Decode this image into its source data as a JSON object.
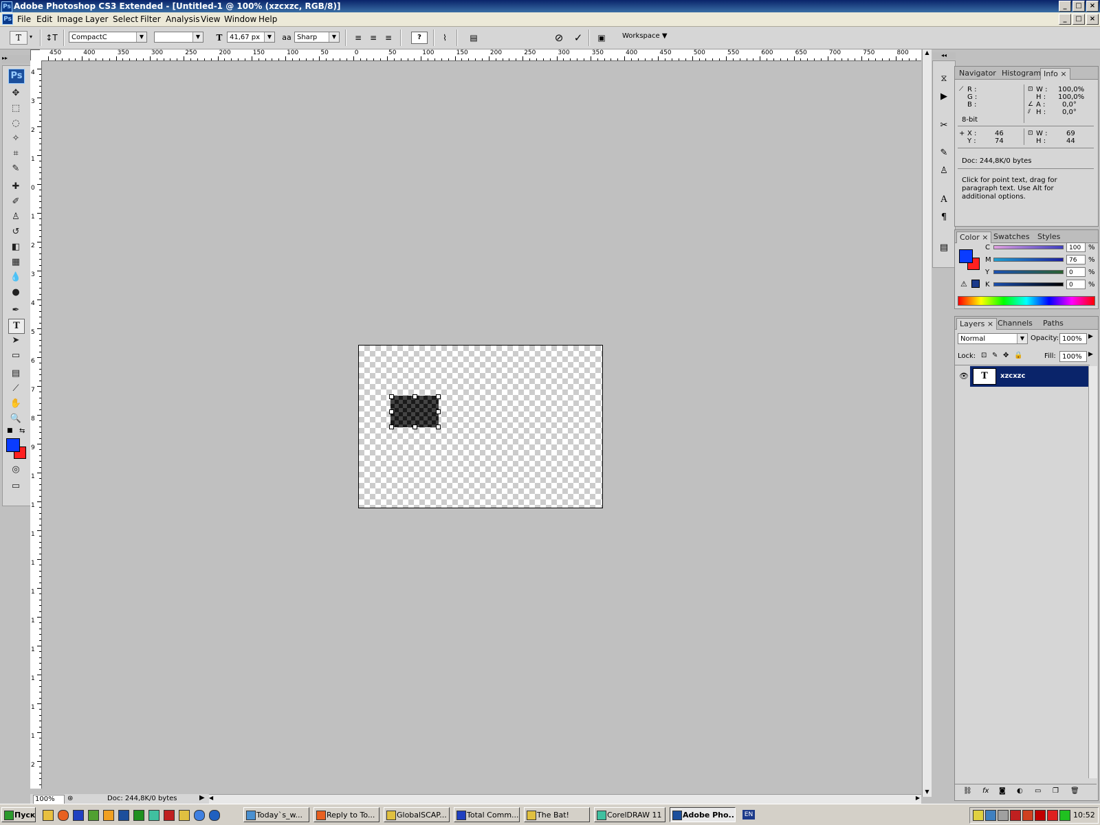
{
  "title": "Adobe Photoshop CS3 Extended - [Untitled-1 @ 100% (xzcxzc, RGB/8)]",
  "menu": [
    "File",
    "Edit",
    "Image",
    "Layer",
    "Select",
    "Filter",
    "Analysis",
    "View",
    "Window",
    "Help"
  ],
  "options": {
    "font_family": "CompactC",
    "font_style": "",
    "font_size": "41,67 px",
    "aa_label": "a",
    "antialias": "Sharp",
    "help_btn": "?",
    "workspace": "Workspace"
  },
  "ruler": {
    "h": [
      "450",
      "400",
      "350",
      "300",
      "250",
      "200",
      "150",
      "100",
      "50",
      "0",
      "50",
      "100",
      "150",
      "200",
      "250",
      "300",
      "350",
      "400",
      "450",
      "500",
      "550",
      "600",
      "650",
      "700",
      "750",
      "800"
    ],
    "v": [
      "4",
      "3",
      "2",
      "1",
      "0",
      "1",
      "2",
      "3",
      "4",
      "5",
      "6",
      "7",
      "8",
      "9",
      "1",
      "1",
      "1",
      "1",
      "1",
      "1",
      "1",
      "1",
      "1",
      "1",
      "2",
      "2"
    ]
  },
  "info_panel": {
    "tabs": [
      "Navigator",
      "Histogram",
      "Info"
    ],
    "r": "R :",
    "g": "G :",
    "b": "B :",
    "bit": "8-bit",
    "w_label": "W :",
    "w_val": "100,0%",
    "h_label": "H :",
    "h_val": "100,0%",
    "a_label": "A :",
    "a_val": "0,0°",
    "h2_label": "H :",
    "h2_val": "0,0°",
    "x_label": "X :",
    "x_val": "46",
    "y_label": "Y :",
    "y_val": "74",
    "sw_label": "W :",
    "sw_val": "69",
    "sh_label": "H :",
    "sh_val": "44",
    "doc": "Doc: 244,8K/0 bytes",
    "hint": "Click for point text, drag for paragraph text. Use Alt for additional options."
  },
  "color_panel": {
    "tabs": [
      "Color",
      "Swatches",
      "Styles"
    ],
    "channels": [
      {
        "label": "C",
        "value": "100",
        "pct": "%"
      },
      {
        "label": "M",
        "value": "76",
        "pct": "%"
      },
      {
        "label": "Y",
        "value": "0",
        "pct": "%"
      },
      {
        "label": "K",
        "value": "0",
        "pct": "%"
      }
    ],
    "fg": "#0a3cff",
    "bg": "#ff2020"
  },
  "layers_panel": {
    "tabs": [
      "Layers",
      "Channels",
      "Paths"
    ],
    "blend": "Normal",
    "opacity_label": "Opacity:",
    "opacity": "100%",
    "lock_label": "Lock:",
    "fill_label": "Fill:",
    "fill": "100%",
    "layer_name": "xzcxzc",
    "layer_thumb": "T"
  },
  "status": {
    "zoom": "100%",
    "doc": "Doc: 244,8K/0 bytes"
  },
  "taskbar": {
    "start": "Пуск",
    "items": [
      "Today`s_w...",
      "Reply to To...",
      "GlobalSCAP...",
      "Total Comm...",
      "The Bat!",
      "CorelDRAW 11",
      "Adobe Pho..."
    ],
    "lang": "EN",
    "clock": "10:52"
  }
}
